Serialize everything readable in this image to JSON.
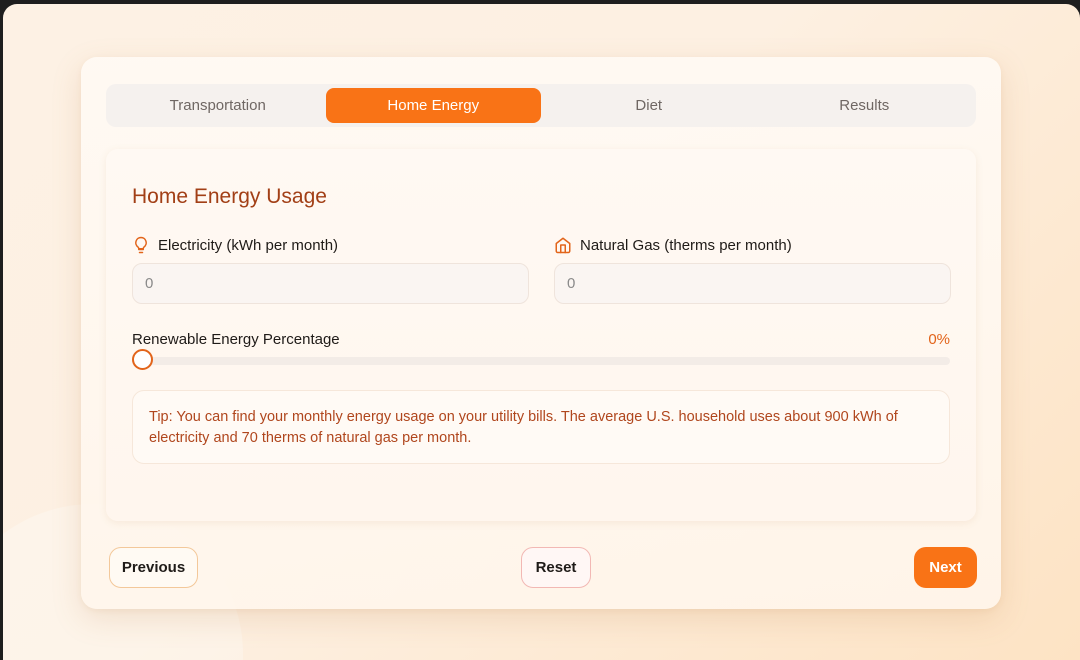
{
  "tabs": [
    {
      "label": "Transportation",
      "active": false
    },
    {
      "label": "Home Energy",
      "active": true
    },
    {
      "label": "Diet",
      "active": false
    },
    {
      "label": "Results",
      "active": false
    }
  ],
  "panel": {
    "title": "Home Energy Usage",
    "electricity": {
      "label": "Electricity (kWh per month)",
      "icon": "lightbulb-icon",
      "value": "0"
    },
    "gas": {
      "label": "Natural Gas (therms per month)",
      "icon": "home-icon",
      "value": "0"
    },
    "renewable": {
      "label": "Renewable Energy Percentage",
      "value_text": "0%",
      "value": 0
    },
    "tip": "Tip: You can find your monthly energy usage on your utility bills. The average U.S. household uses about 900 kWh of electricity and 70 therms of natural gas per month."
  },
  "buttons": {
    "previous": "Previous",
    "reset": "Reset",
    "next": "Next"
  },
  "colors": {
    "accent": "#f97316",
    "title": "#a23f16",
    "tip_text": "#b0461d"
  }
}
